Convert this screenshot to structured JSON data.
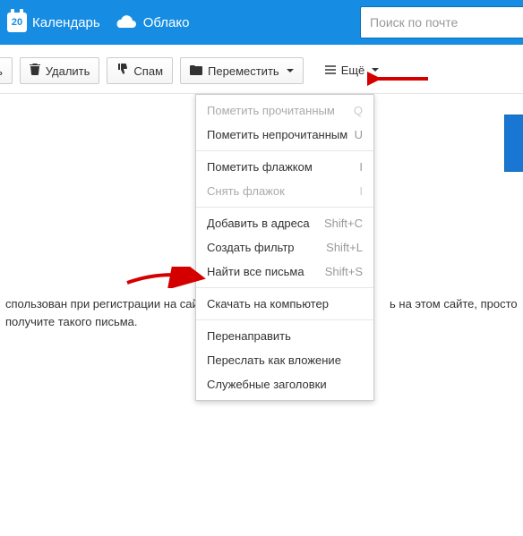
{
  "topbar": {
    "calendar_label": "Календарь",
    "calendar_day": "20",
    "cloud_label": "Облако",
    "search_placeholder": "Поиск по почте"
  },
  "toolbar": {
    "first_partial": "ь",
    "delete_label": "Удалить",
    "spam_label": "Спам",
    "move_label": "Переместить",
    "more_label": "Ещё"
  },
  "menu": {
    "mark_read": {
      "label": "Пометить прочитанным",
      "key": "Q"
    },
    "mark_unread": {
      "label": "Пометить непрочитанным",
      "key": "U"
    },
    "flag": {
      "label": "Пометить флажком",
      "key": "I"
    },
    "unflag": {
      "label": "Снять флажок",
      "key": "I"
    },
    "add_addr": {
      "label": "Добавить в адреса",
      "key": "Shift+C"
    },
    "create_filter": {
      "label": "Создать фильтр",
      "key": "Shift+L"
    },
    "find_all": {
      "label": "Найти все письма",
      "key": "Shift+S"
    },
    "download": {
      "label": "Скачать на компьютер"
    },
    "redirect": {
      "label": "Перенаправить"
    },
    "forward_attach": {
      "label": "Переслать как вложение"
    },
    "headers": {
      "label": "Служебные заголовки"
    }
  },
  "body": {
    "line1_left": "спользован при регистрации на сайт",
    "line1_right": "ь на этом сайте, просто",
    "line2": "получите такого письма."
  }
}
